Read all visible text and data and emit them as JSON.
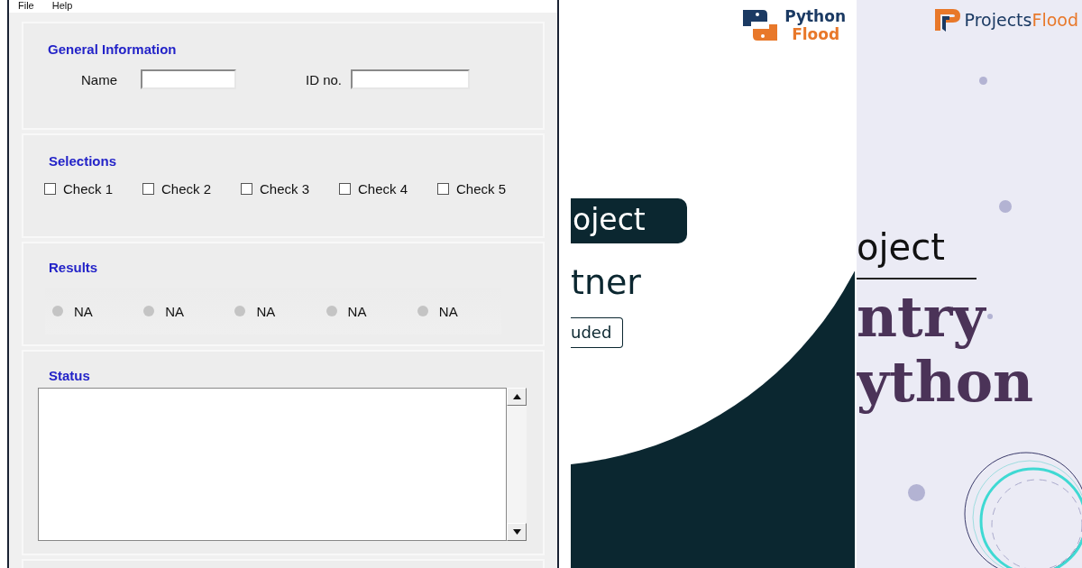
{
  "app": {
    "menu": [
      "File",
      "Help"
    ],
    "general": {
      "title": "General Information",
      "fields": [
        {
          "label": "Name"
        },
        {
          "label": "ID no."
        }
      ]
    },
    "selections": {
      "title": "Selections",
      "checks": [
        {
          "label": "Check 1",
          "checked": false
        },
        {
          "label": "Check 2",
          "checked": false
        },
        {
          "label": "Check 3",
          "checked": false
        },
        {
          "label": "Check 4",
          "checked": false
        },
        {
          "label": "Check 5",
          "checked": false
        }
      ]
    },
    "results": {
      "title": "Results",
      "items": [
        "NA",
        "NA",
        "NA",
        "NA",
        "NA"
      ]
    },
    "status": {
      "title": "Status"
    }
  },
  "banner_left": {
    "logo": {
      "top": "Python",
      "bottom": "Flood"
    },
    "pill": "oject",
    "heading": "tner",
    "tag": "uded"
  },
  "banner_right": {
    "logo": {
      "first": "Projects",
      "second": "Flood"
    },
    "kicker": "oject",
    "lines": [
      "ntry",
      "ython"
    ]
  }
}
